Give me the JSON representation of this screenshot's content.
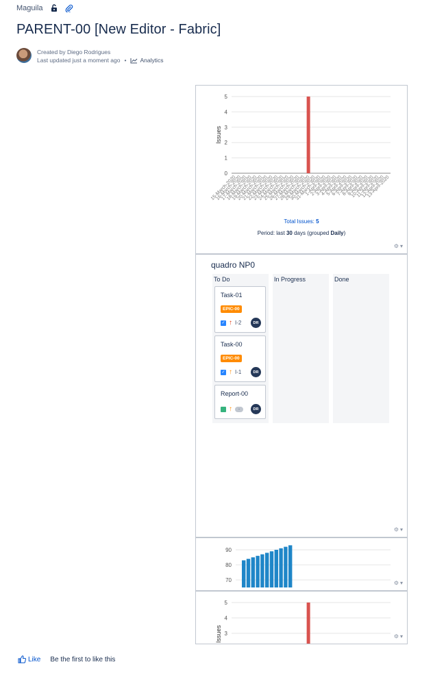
{
  "breadcrumb": {
    "space": "Maguila",
    "icons": [
      "unlock-icon",
      "attachment-icon"
    ]
  },
  "page": {
    "title": "PARENT-00 [New Editor - Fabric]"
  },
  "byline": {
    "created": "Created by Diego Rodrigues",
    "updated": "Last updated just a moment ago",
    "separator": "•",
    "analytics": "Analytics"
  },
  "issues_chart": {
    "total_label": "Total Issues:",
    "total_value": "5",
    "period_prefix": "Period: last",
    "period_days": "30",
    "period_mid": "days (grouped",
    "period_group": "Daily",
    "period_suffix": ")"
  },
  "board": {
    "title": "quadro NP0",
    "columns": [
      "To Do",
      "In Progress",
      "Done"
    ],
    "cards": [
      {
        "title": "Task-01",
        "epic": "EPIC-00",
        "type": "checkbox-icon",
        "priority": "high",
        "key": "I-2",
        "assignee": "DR"
      },
      {
        "title": "Task-00",
        "epic": "EPIC-00",
        "type": "checkbox-icon",
        "priority": "medium",
        "key": "I-1",
        "assignee": "DR"
      },
      {
        "title": "Report-00",
        "epic": "",
        "type": "story-icon",
        "priority": "medium",
        "key": "-",
        "assignee": "DR"
      }
    ]
  },
  "footer": {
    "like": "Like",
    "like_text": "Be the first to like this"
  },
  "colors": {
    "bar_red": "#d9534f",
    "bar_blue": "#1f86c8",
    "link": "#0052cc",
    "epic": "#ff8b00"
  },
  "chart_data": [
    {
      "type": "bar",
      "ylabel": "Issues",
      "ylim": [
        0,
        5
      ],
      "yticks": [
        0,
        1,
        2,
        3,
        4,
        5
      ],
      "categories": [
        "15-March-2020",
        "16-March-2020",
        "17-March-2020",
        "18-March-2020",
        "19-March-2020",
        "20-March-2020",
        "21-March-2020",
        "22-March-2020",
        "23-March-2020",
        "24-March-2020",
        "25-March-2020",
        "26-March-2020",
        "27-March-2020",
        "28-March-2020",
        "29-March-2020",
        "30-March-2020",
        "31-March-2020",
        "1-April-2020",
        "2-April-2020",
        "3-April-2020",
        "4-April-2020",
        "5-April-2020",
        "6-April-2020",
        "7-April-2020",
        "8-April-2020",
        "9-April-2020",
        "10-April-2020",
        "11-April-2020",
        "12-April-2020",
        "13-April-2020"
      ],
      "values": [
        0,
        0,
        0,
        0,
        0,
        0,
        0,
        0,
        0,
        0,
        0,
        0,
        0,
        0,
        5,
        0,
        0,
        0,
        0,
        0,
        0,
        0,
        0,
        0,
        0,
        0,
        0,
        0,
        0,
        0
      ]
    },
    {
      "type": "bar",
      "ylim": [
        65,
        95
      ],
      "yticks": [
        70,
        80,
        90
      ],
      "values": [
        83,
        84,
        85,
        86,
        87,
        88,
        89,
        90,
        91,
        92,
        93
      ]
    },
    {
      "type": "bar",
      "ylabel": "Issues",
      "yticks": [
        3,
        4,
        5
      ],
      "ylim": [
        0,
        5
      ],
      "values": [
        0,
        0,
        0,
        0,
        0,
        0,
        0,
        0,
        0,
        0,
        0,
        0,
        0,
        0,
        5,
        0,
        0,
        0,
        0,
        0,
        0,
        0,
        0,
        0,
        0,
        0,
        0,
        0,
        0,
        0
      ]
    }
  ]
}
